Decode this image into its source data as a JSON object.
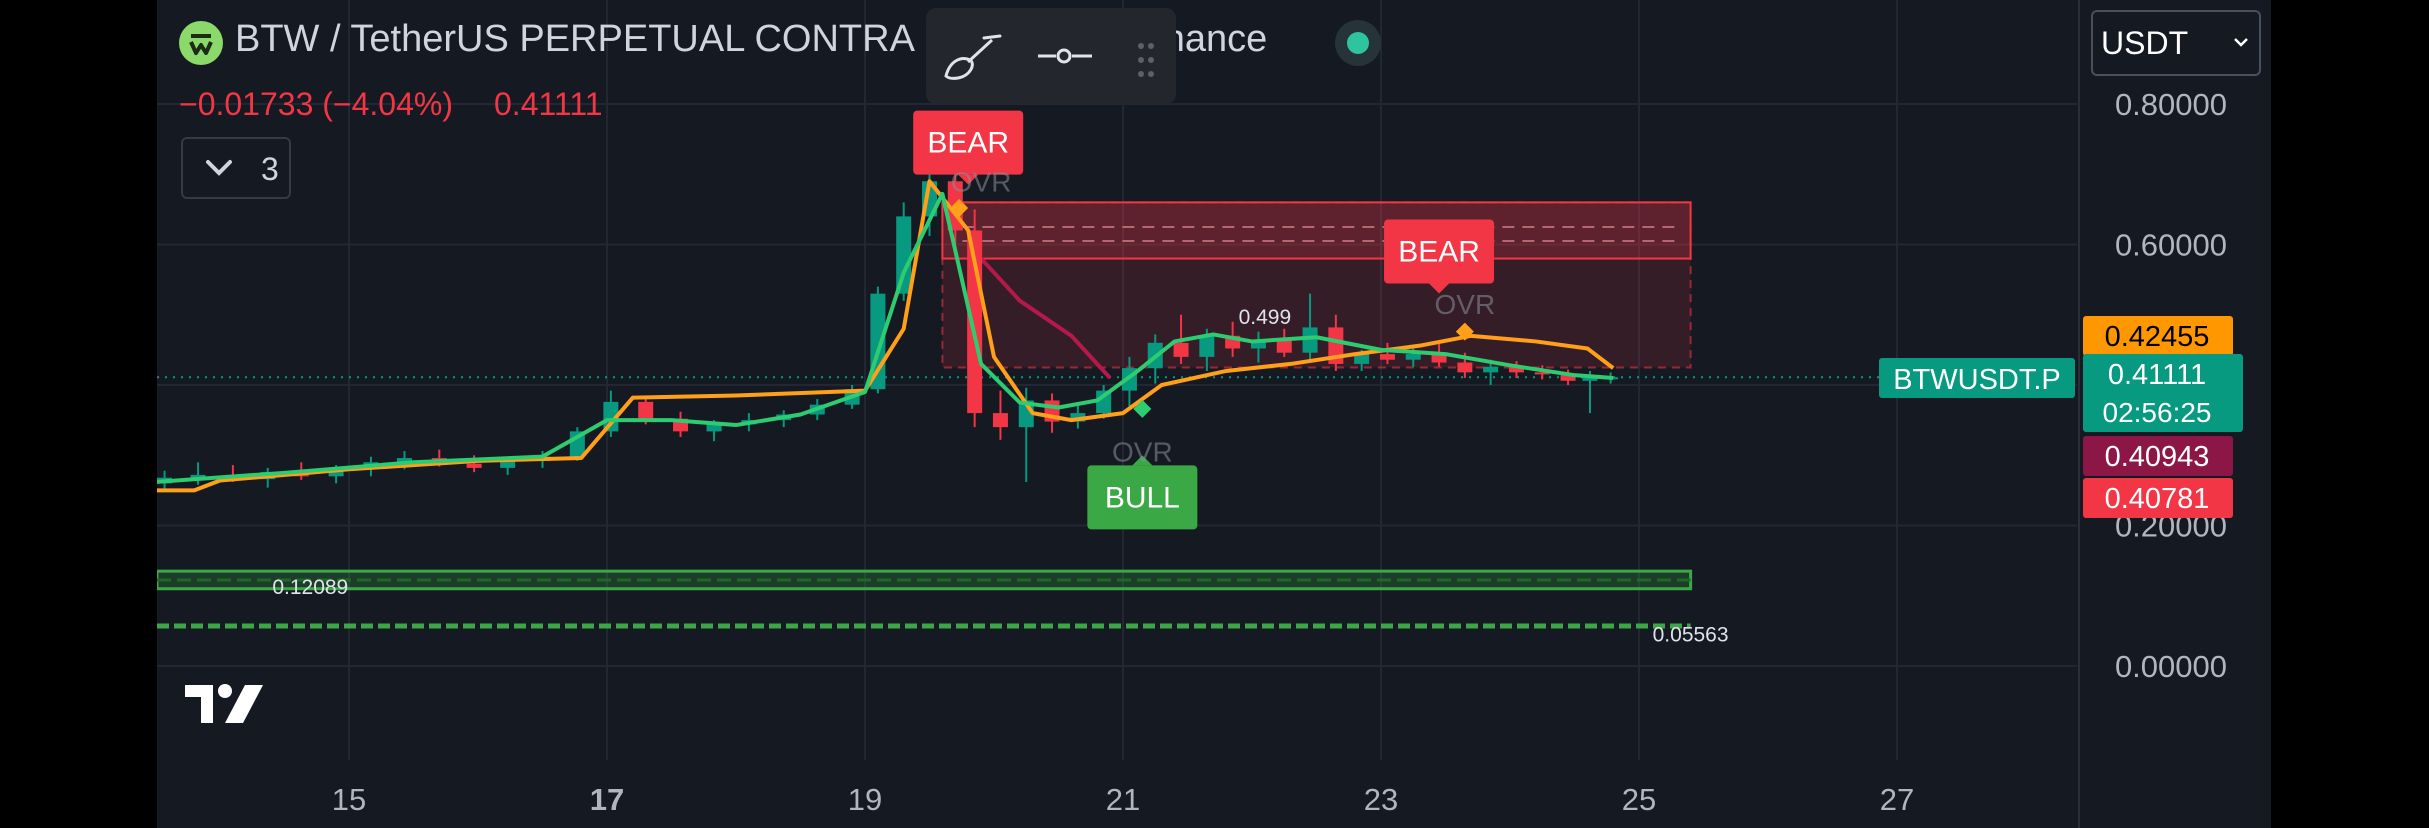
{
  "header": {
    "title_left": "BTW / TetherUS PERPETUAL CONTRA",
    "title_right": "Binance",
    "change": "−0.01733 (−4.04%)",
    "last": "0.41111",
    "indicators_count": "3",
    "logo_icon": "btw-coin-icon",
    "status_icon": "market-status-dot"
  },
  "drawing_toolbar": {
    "tools": [
      "brush-icon",
      "line-tool-icon",
      "drag-handle-icon"
    ]
  },
  "currency": {
    "selected": "USDT"
  },
  "colors": {
    "background": "#151922",
    "up": "#089981",
    "down": "#f23645",
    "ema_fast": "#2ecc71",
    "ema_slow": "#ff9f1a",
    "bear_label": "#f23645",
    "bull_label": "#3aa845"
  },
  "chart_data": {
    "type": "candlestick",
    "symbol": "BTWUSDT.P",
    "x_ticks": [
      "15",
      "17",
      "19",
      "21",
      "23",
      "25",
      "27"
    ],
    "x_tick_days": [
      15,
      17,
      19,
      21,
      23,
      25,
      27
    ],
    "bold_ticks": [
      "17"
    ],
    "xlim": [
      13.5,
      28.5
    ],
    "ylim": [
      -0.045,
      0.855
    ],
    "y_ticks": [
      "0.80000",
      "0.60000",
      "0.20000",
      "0.00000"
    ],
    "y_tick_values": [
      0.8,
      0.6,
      0.2,
      0.0
    ],
    "grid": true,
    "candles": [
      {
        "x": 13.57,
        "o": 0.26,
        "h": 0.278,
        "l": 0.25,
        "c": 0.268
      },
      {
        "x": 13.83,
        "o": 0.268,
        "h": 0.29,
        "l": 0.258,
        "c": 0.272
      },
      {
        "x": 14.1,
        "o": 0.272,
        "h": 0.286,
        "l": 0.262,
        "c": 0.266
      },
      {
        "x": 14.37,
        "o": 0.266,
        "h": 0.282,
        "l": 0.254,
        "c": 0.276
      },
      {
        "x": 14.63,
        "o": 0.276,
        "h": 0.29,
        "l": 0.265,
        "c": 0.27
      },
      {
        "x": 14.9,
        "o": 0.27,
        "h": 0.286,
        "l": 0.26,
        "c": 0.28
      },
      {
        "x": 15.17,
        "o": 0.28,
        "h": 0.298,
        "l": 0.27,
        "c": 0.29
      },
      {
        "x": 15.43,
        "o": 0.29,
        "h": 0.306,
        "l": 0.28,
        "c": 0.296
      },
      {
        "x": 15.7,
        "o": 0.296,
        "h": 0.308,
        "l": 0.284,
        "c": 0.288
      },
      {
        "x": 15.97,
        "o": 0.288,
        "h": 0.3,
        "l": 0.276,
        "c": 0.282
      },
      {
        "x": 16.23,
        "o": 0.282,
        "h": 0.296,
        "l": 0.272,
        "c": 0.292
      },
      {
        "x": 16.5,
        "o": 0.292,
        "h": 0.306,
        "l": 0.282,
        "c": 0.298
      },
      {
        "x": 16.77,
        "o": 0.298,
        "h": 0.34,
        "l": 0.292,
        "c": 0.334
      },
      {
        "x": 17.03,
        "o": 0.334,
        "h": 0.392,
        "l": 0.326,
        "c": 0.376
      },
      {
        "x": 17.3,
        "o": 0.376,
        "h": 0.38,
        "l": 0.344,
        "c": 0.352
      },
      {
        "x": 17.57,
        "o": 0.352,
        "h": 0.362,
        "l": 0.326,
        "c": 0.334
      },
      {
        "x": 17.83,
        "o": 0.334,
        "h": 0.35,
        "l": 0.32,
        "c": 0.344
      },
      {
        "x": 18.1,
        "o": 0.344,
        "h": 0.36,
        "l": 0.334,
        "c": 0.35
      },
      {
        "x": 18.37,
        "o": 0.35,
        "h": 0.364,
        "l": 0.34,
        "c": 0.358
      },
      {
        "x": 18.63,
        "o": 0.358,
        "h": 0.38,
        "l": 0.35,
        "c": 0.372
      },
      {
        "x": 18.9,
        "o": 0.372,
        "h": 0.4,
        "l": 0.366,
        "c": 0.394
      },
      {
        "x": 19.1,
        "o": 0.394,
        "h": 0.54,
        "l": 0.388,
        "c": 0.53
      },
      {
        "x": 19.3,
        "o": 0.53,
        "h": 0.66,
        "l": 0.52,
        "c": 0.64
      },
      {
        "x": 19.5,
        "o": 0.64,
        "h": 0.712,
        "l": 0.612,
        "c": 0.69
      },
      {
        "x": 19.7,
        "o": 0.69,
        "h": 0.7,
        "l": 0.6,
        "c": 0.62
      },
      {
        "x": 19.85,
        "o": 0.62,
        "h": 0.65,
        "l": 0.34,
        "c": 0.36
      },
      {
        "x": 20.05,
        "o": 0.36,
        "h": 0.392,
        "l": 0.322,
        "c": 0.34
      },
      {
        "x": 20.25,
        "o": 0.34,
        "h": 0.396,
        "l": 0.262,
        "c": 0.378
      },
      {
        "x": 20.45,
        "o": 0.378,
        "h": 0.388,
        "l": 0.332,
        "c": 0.348
      },
      {
        "x": 20.65,
        "o": 0.348,
        "h": 0.372,
        "l": 0.338,
        "c": 0.36
      },
      {
        "x": 20.85,
        "o": 0.36,
        "h": 0.4,
        "l": 0.352,
        "c": 0.392
      },
      {
        "x": 21.05,
        "o": 0.392,
        "h": 0.44,
        "l": 0.37,
        "c": 0.424
      },
      {
        "x": 21.25,
        "o": 0.424,
        "h": 0.472,
        "l": 0.402,
        "c": 0.46
      },
      {
        "x": 21.45,
        "o": 0.46,
        "h": 0.5,
        "l": 0.43,
        "c": 0.44
      },
      {
        "x": 21.65,
        "o": 0.44,
        "h": 0.48,
        "l": 0.42,
        "c": 0.47
      },
      {
        "x": 21.85,
        "o": 0.47,
        "h": 0.49,
        "l": 0.44,
        "c": 0.452
      },
      {
        "x": 22.05,
        "o": 0.452,
        "h": 0.476,
        "l": 0.432,
        "c": 0.464
      },
      {
        "x": 22.25,
        "o": 0.464,
        "h": 0.48,
        "l": 0.44,
        "c": 0.446
      },
      {
        "x": 22.45,
        "o": 0.446,
        "h": 0.53,
        "l": 0.436,
        "c": 0.482
      },
      {
        "x": 22.65,
        "o": 0.482,
        "h": 0.5,
        "l": 0.42,
        "c": 0.43
      },
      {
        "x": 22.85,
        "o": 0.43,
        "h": 0.45,
        "l": 0.42,
        "c": 0.444
      },
      {
        "x": 23.05,
        "o": 0.444,
        "h": 0.46,
        "l": 0.43,
        "c": 0.436
      },
      {
        "x": 23.25,
        "o": 0.436,
        "h": 0.452,
        "l": 0.426,
        "c": 0.444
      },
      {
        "x": 23.45,
        "o": 0.444,
        "h": 0.462,
        "l": 0.426,
        "c": 0.432
      },
      {
        "x": 23.65,
        "o": 0.432,
        "h": 0.446,
        "l": 0.41,
        "c": 0.418
      },
      {
        "x": 23.85,
        "o": 0.418,
        "h": 0.436,
        "l": 0.4,
        "c": 0.426
      },
      {
        "x": 24.05,
        "o": 0.426,
        "h": 0.434,
        "l": 0.41,
        "c": 0.418
      },
      {
        "x": 24.25,
        "o": 0.418,
        "h": 0.428,
        "l": 0.408,
        "c": 0.416
      },
      {
        "x": 24.45,
        "o": 0.416,
        "h": 0.422,
        "l": 0.4,
        "c": 0.406
      },
      {
        "x": 24.62,
        "o": 0.406,
        "h": 0.42,
        "l": 0.36,
        "c": 0.41
      },
      {
        "x": 24.78,
        "o": 0.41,
        "h": 0.418,
        "l": 0.402,
        "c": 0.411
      }
    ],
    "ema_fast": [
      [
        13.5,
        0.262
      ],
      [
        14.5,
        0.275
      ],
      [
        15.5,
        0.29
      ],
      [
        16.5,
        0.298
      ],
      [
        17.0,
        0.35
      ],
      [
        17.5,
        0.35
      ],
      [
        18.0,
        0.343
      ],
      [
        18.5,
        0.358
      ],
      [
        19.0,
        0.39
      ],
      [
        19.3,
        0.56
      ],
      [
        19.6,
        0.672
      ],
      [
        19.9,
        0.43
      ],
      [
        20.2,
        0.375
      ],
      [
        20.5,
        0.368
      ],
      [
        20.8,
        0.378
      ],
      [
        21.1,
        0.418
      ],
      [
        21.4,
        0.462
      ],
      [
        21.7,
        0.472
      ],
      [
        22.0,
        0.462
      ],
      [
        22.5,
        0.468
      ],
      [
        23.0,
        0.45
      ],
      [
        23.5,
        0.444
      ],
      [
        24.0,
        0.428
      ],
      [
        24.5,
        0.414
      ],
      [
        24.8,
        0.41
      ]
    ],
    "ema_slow": [
      [
        13.5,
        0.25
      ],
      [
        13.8,
        0.25
      ],
      [
        14.0,
        0.264
      ],
      [
        15.0,
        0.28
      ],
      [
        16.0,
        0.292
      ],
      [
        16.8,
        0.296
      ],
      [
        17.2,
        0.382
      ],
      [
        18.0,
        0.385
      ],
      [
        19.0,
        0.392
      ],
      [
        19.3,
        0.48
      ],
      [
        19.5,
        0.69
      ],
      [
        19.8,
        0.62
      ],
      [
        20.0,
        0.44
      ],
      [
        20.3,
        0.36
      ],
      [
        20.6,
        0.35
      ],
      [
        21.0,
        0.36
      ],
      [
        21.3,
        0.4
      ],
      [
        21.8,
        0.42
      ],
      [
        22.3,
        0.43
      ],
      [
        22.8,
        0.444
      ],
      [
        23.3,
        0.456
      ],
      [
        23.7,
        0.47
      ],
      [
        24.2,
        0.462
      ],
      [
        24.6,
        0.452
      ],
      [
        24.8,
        0.424
      ]
    ],
    "signal_line": [
      [
        19.9,
        0.58
      ],
      [
        20.2,
        0.52
      ],
      [
        20.6,
        0.47
      ],
      [
        20.9,
        0.41
      ]
    ],
    "zone": {
      "x1": 19.6,
      "x2": 25.4,
      "y1": 0.425,
      "y2": 0.66,
      "inner_y1": 0.58,
      "inner_y2": 0.66
    },
    "support_zone": {
      "x1": 13.5,
      "x2": 25.4,
      "y1": 0.11,
      "y2": 0.135
    },
    "support_line": {
      "x1": 13.5,
      "x2": 25.4,
      "y": 0.057
    },
    "labels": [
      {
        "text": "BEAR",
        "x": 19.8,
        "y": 0.745,
        "kind": "bear"
      },
      {
        "text": "BEAR",
        "x": 23.45,
        "y": 0.59,
        "kind": "bear"
      },
      {
        "text": "BULL",
        "x": 21.15,
        "y": 0.24,
        "kind": "bull"
      },
      {
        "text": "OVR",
        "x": 19.9,
        "y": 0.69,
        "kind": "faint"
      },
      {
        "text": "OVR",
        "x": 23.65,
        "y": 0.515,
        "kind": "faint"
      },
      {
        "text": "OVR",
        "x": 21.15,
        "y": 0.305,
        "kind": "faint"
      },
      {
        "text": "0.499",
        "x": 22.1,
        "y": 0.498,
        "kind": "value"
      },
      {
        "text": "0.12089",
        "x": 14.7,
        "y": 0.114,
        "kind": "value"
      },
      {
        "text": "0.05563",
        "x": 25.4,
        "y": 0.046,
        "kind": "value"
      }
    ],
    "markers": [
      {
        "x": 19.73,
        "y": 0.652,
        "color": "#ff9f1a"
      },
      {
        "x": 23.65,
        "y": 0.476,
        "color": "#ff9f1a"
      },
      {
        "x": 21.15,
        "y": 0.366,
        "color": "#2ecc71"
      }
    ],
    "price_line": 0.41111,
    "price_tags": [
      {
        "text": "0.42455",
        "value": 0.42455,
        "bg": "#ff9800",
        "fg": "#000000"
      },
      {
        "text": "0.41111",
        "sub": "02:56:25",
        "value": 0.41111,
        "bg": "#089981",
        "fg": "#ffffff"
      },
      {
        "text": "0.40943",
        "value": 0.40943,
        "bg": "#8c1746",
        "fg": "#ffffff"
      },
      {
        "text": "0.40781",
        "value": 0.40781,
        "bg": "#f23645",
        "fg": "#ffffff"
      }
    ],
    "symbol_tag": "BTWUSDT.P"
  }
}
